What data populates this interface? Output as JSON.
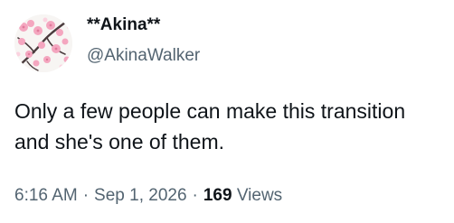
{
  "author": {
    "display_name": "**Akina**",
    "handle": "@AkinaWalker",
    "avatar_icon": "cherry-blossom-avatar"
  },
  "tweet": {
    "text": "Only a few people can make this transition and she's one of them."
  },
  "meta": {
    "time": "6:16 AM",
    "separator": "·",
    "date": "Sep 1, 2026",
    "views_count": "169",
    "views_label": "Views"
  },
  "colors": {
    "primary_text": "#0f1419",
    "secondary_text": "#536471",
    "blossom_pink": "#f4a6bf",
    "branch_dark": "#4a3b3d"
  }
}
